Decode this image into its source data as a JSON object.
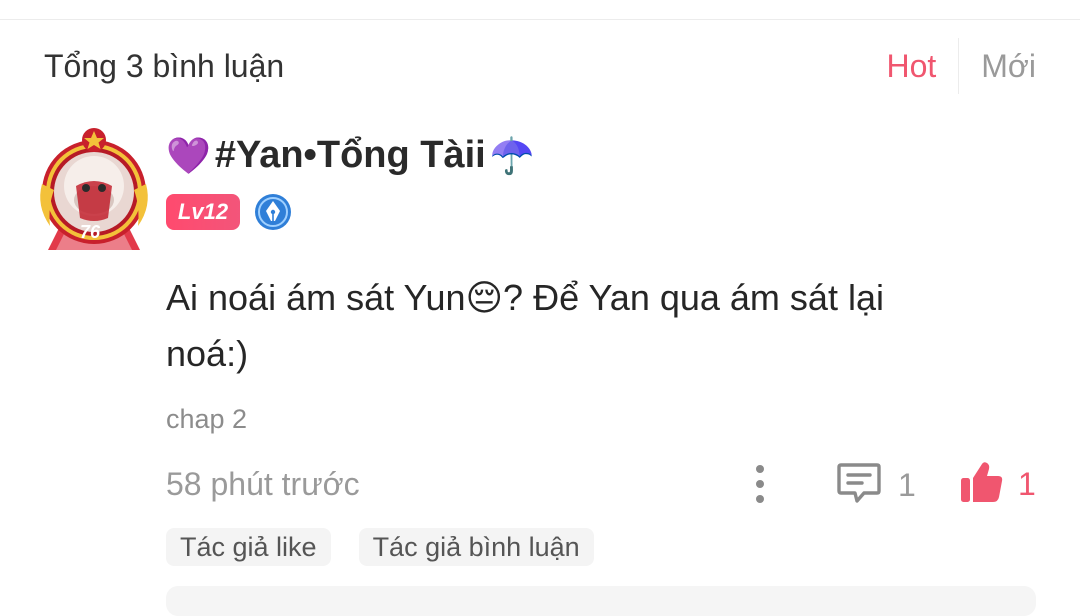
{
  "header": {
    "comment_count": "Tổng 3 bình luận",
    "sort_hot": "Hot",
    "sort_new": "Mới"
  },
  "comment": {
    "username_emoji_left": "💜",
    "username": "#Yan•Tổng Tàii",
    "username_emoji_right": "☂️",
    "level": "Lv12",
    "avatar_frame_number": "76",
    "content_line1": "Ai noái ám sát Yun😔? Để Yan qua ám sát lại",
    "content_line2": "noá:)",
    "chapter": "chap 2",
    "time": "58 phút trước",
    "reply_count": "1",
    "like_count": "1",
    "tags": [
      "Tác giả like",
      "Tác giả bình luận"
    ]
  },
  "icons": {
    "more": "more-vertical-icon",
    "reply": "comment-bubble-icon",
    "like": "thumbs-up-icon",
    "role": "pen-nib-badge-icon"
  },
  "colors": {
    "accent": "#f0566f",
    "muted": "#9a9a9a",
    "tag_bg": "#f4f4f4"
  }
}
